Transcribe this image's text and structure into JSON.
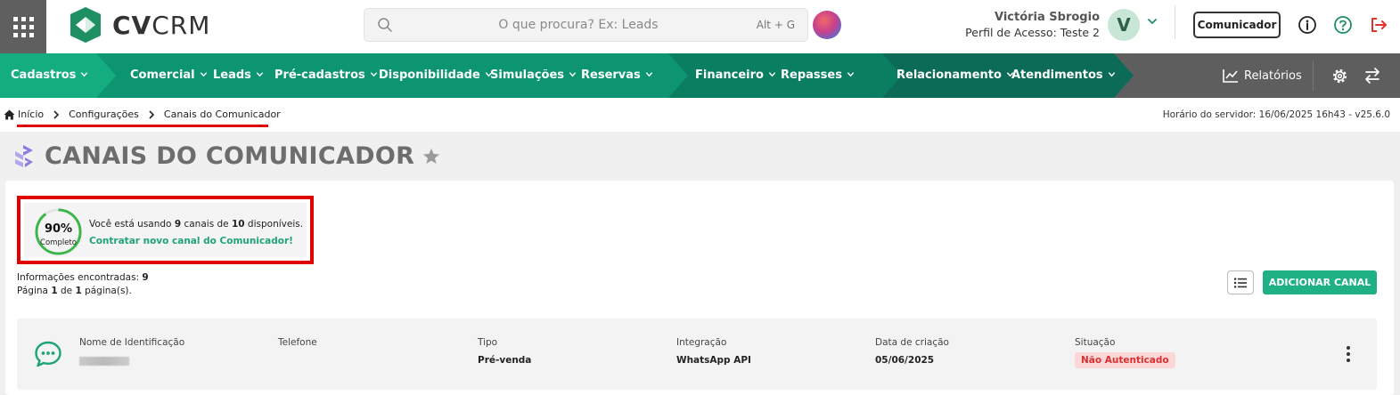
{
  "header": {
    "logo_bold": "CV",
    "logo_light": "CRM",
    "search": {
      "placeholder": "O que procura? Ex: Leads",
      "shortcut": "Alt + G"
    },
    "user": {
      "name": "Victória Sbrogio",
      "profile": "Perfil de Acesso: Teste 2",
      "avatar_letter": "V"
    },
    "communicator_label": "Comunicador",
    "icons": [
      "apps-grid-icon",
      "search-icon",
      "chevron-down-icon",
      "info-icon",
      "help-icon",
      "logout-icon"
    ]
  },
  "nav": {
    "items": [
      {
        "label": "Cadastros"
      },
      {
        "label": "Comercial"
      },
      {
        "label": "Leads"
      },
      {
        "label": "Pré-cadastros"
      },
      {
        "label": "Disponibilidade"
      },
      {
        "label": "Simulações"
      },
      {
        "label": "Reservas"
      },
      {
        "label": "Financeiro"
      },
      {
        "label": "Repasses"
      },
      {
        "label": "Relacionamento"
      },
      {
        "label": "Atendimentos"
      }
    ],
    "reports_label": "Relatórios"
  },
  "breadcrumb": {
    "items": [
      "Início",
      "Configurações",
      "Canais do Comunicador"
    ],
    "server_time": "Horário do servidor: 16/06/2025 16h43 - v25.6.0"
  },
  "page": {
    "title": "CANAIS DO COMUNICADOR"
  },
  "usage": {
    "percent": 90,
    "percent_text": "90%",
    "percent_label": "Completo",
    "text_prefix": "Você está usando ",
    "used": "9",
    "text_mid": " canais de ",
    "total": "10",
    "text_suffix": " disponíveis.",
    "link": "Contratar novo canal do Comunicador!"
  },
  "info": {
    "found_label": "Informações encontradas: ",
    "found_count": "9",
    "page_prefix": "Página ",
    "page_current": "1",
    "page_mid": " de ",
    "page_total": "1",
    "page_suffix": " página(s)."
  },
  "actions": {
    "add_channel": "ADICIONAR CANAL"
  },
  "colors": {
    "primary": "#1fb084",
    "nav_bg": "#5e5e5e",
    "danger": "#d93030",
    "highlight": "#e00000"
  },
  "channels": {
    "columns": [
      "Nome de Identificação",
      "Telefone",
      "Tipo",
      "Integração",
      "Data de criação",
      "Situação"
    ],
    "rows": [
      {
        "tipo": "Pré-venda",
        "integracao": "WhatsApp API",
        "data": "05/06/2025",
        "situacao": "Não Autenticado"
      }
    ]
  }
}
